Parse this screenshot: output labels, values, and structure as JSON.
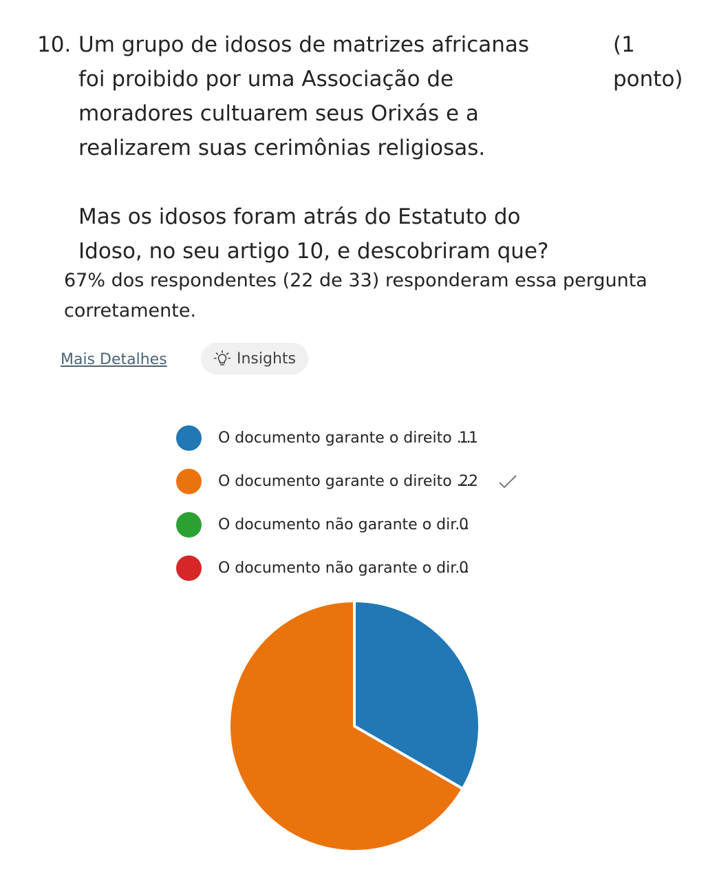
{
  "question": {
    "number": "10.",
    "text_p1": "Um grupo de idosos de matrizes africanas foi proibido por uma Associação de moradores cultuarem seus Orixás e a realizarem suas cerimônias religiosas.",
    "text_p2": "Mas os idosos foram atrás do Estatuto do Idoso, no seu artigo 10, e descobriram que?",
    "points": "(1 ponto)"
  },
  "summary": "67% dos respondentes (22 de 33) responderam essa pergunta corretamente.",
  "actions": {
    "details_link": "Mais Detalhes",
    "insights_label": "Insights",
    "insights_icon": "lightbulb-icon"
  },
  "correct_icon": "checkmark-icon",
  "chart_data": {
    "type": "pie",
    "legend_position": "top",
    "slices": [
      {
        "label": "O documento garante o direito ...",
        "value": 11,
        "color": "#2178b5",
        "correct": false
      },
      {
        "label": "O documento garante o direito ...",
        "value": 22,
        "color": "#eb730c",
        "correct": true
      },
      {
        "label": "O documento não garante o dir...",
        "value": 0,
        "color": "#2ba131",
        "correct": false
      },
      {
        "label": "O documento não garante o dir...",
        "value": 0,
        "color": "#d72628",
        "correct": false
      }
    ]
  }
}
